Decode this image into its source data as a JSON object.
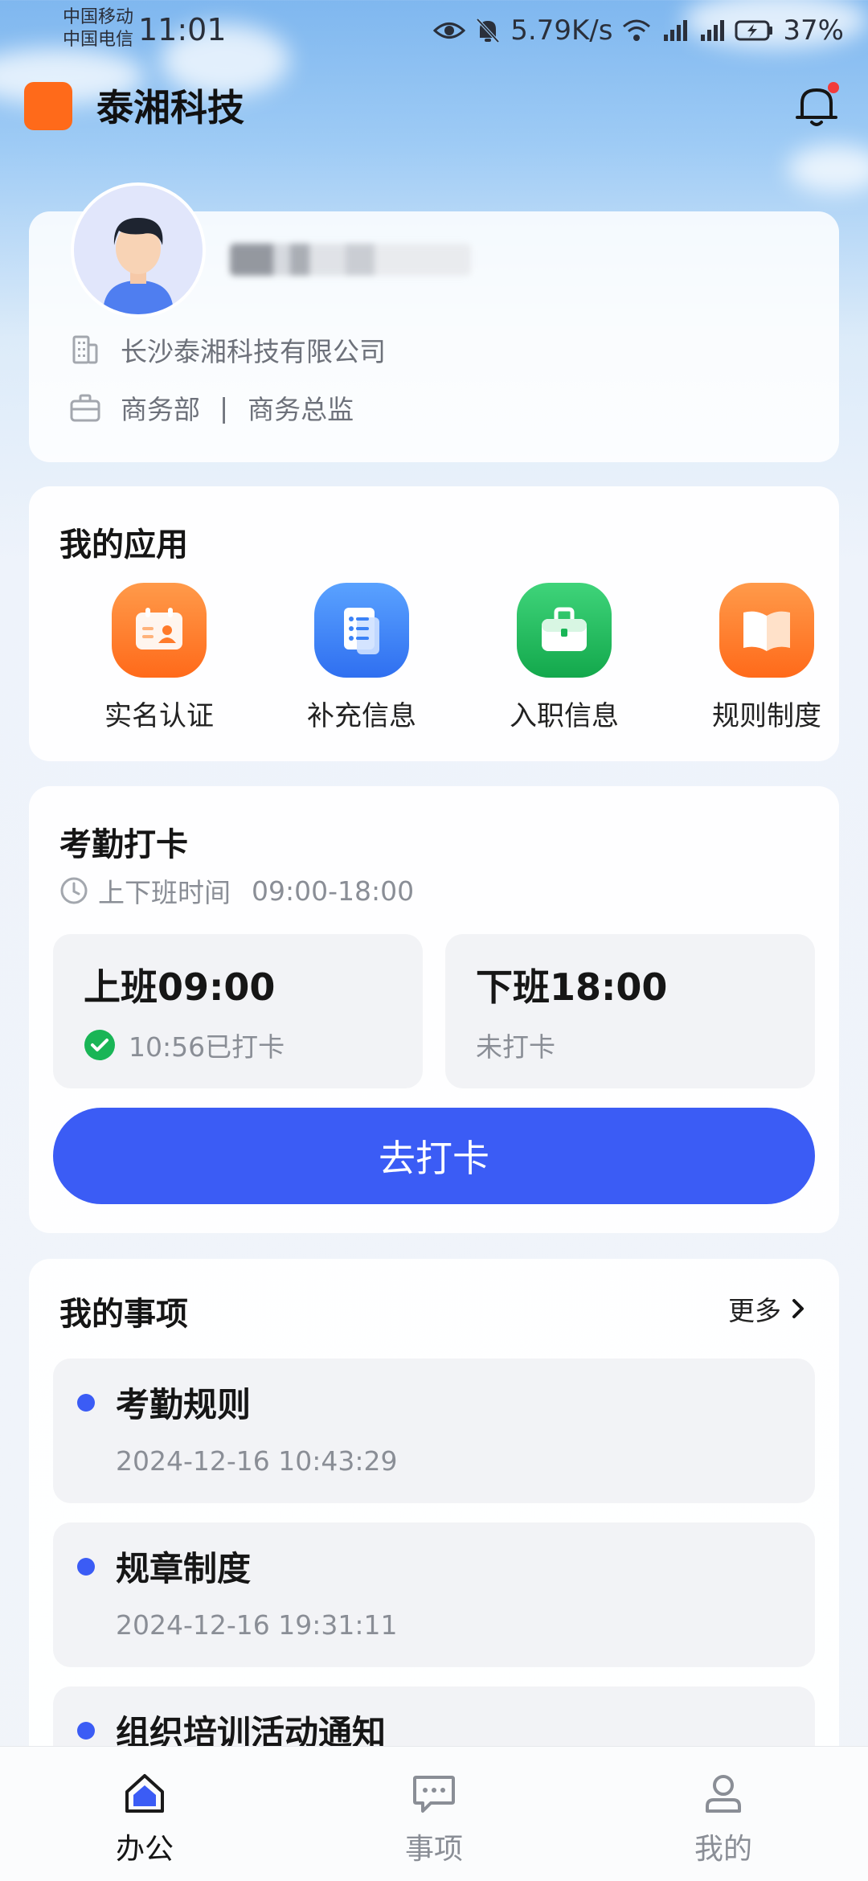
{
  "status_bar": {
    "carrier_1": "中国移动",
    "carrier_2": "中国电信",
    "time": "11:01",
    "net_speed": "5.79K/s",
    "battery": "37%",
    "icons": [
      "eye-icon",
      "mute-bell-icon",
      "wifi-icon",
      "signal-4g-icon",
      "signal-4g-icon",
      "battery-charging-icon"
    ]
  },
  "header": {
    "title": "泰湘科技",
    "logo_color": "#ff6a1a",
    "bell_icon": "bell-icon",
    "has_notification_dot": true
  },
  "profile": {
    "company": "长沙泰湘科技有限公司",
    "department": "商务部",
    "position": "商务总监",
    "separator": "|"
  },
  "apps": {
    "title": "我的应用",
    "items": [
      {
        "label": "实名认证",
        "icon": "id-card-icon",
        "color": "#ff6a1a"
      },
      {
        "label": "补充信息",
        "icon": "document-icon",
        "color": "#3b82f6"
      },
      {
        "label": "入职信息",
        "icon": "briefcase-icon",
        "color": "#19b556"
      },
      {
        "label": "规则制度",
        "icon": "book-icon",
        "color": "#ff6a1a"
      }
    ]
  },
  "attendance": {
    "title": "考勤打卡",
    "hours_label": "上下班时间",
    "hours_value": "09:00-18:00",
    "checkin": {
      "title": "上班09:00",
      "status": "10:56已打卡"
    },
    "checkout": {
      "title": "下班18:00",
      "status": "未打卡"
    },
    "button": "去打卡",
    "accent_color": "#3b5cf5"
  },
  "matters": {
    "title": "我的事项",
    "more": "更多",
    "items": [
      {
        "title": "考勤规则",
        "time": "2024-12-16 10:43:29"
      },
      {
        "title": "规章制度",
        "time": "2024-12-16 19:31:11"
      },
      {
        "title": "组织培训活动通知",
        "time": ""
      }
    ]
  },
  "tabbar": {
    "tabs": [
      {
        "label": "办公",
        "icon": "home-icon",
        "active": true
      },
      {
        "label": "事项",
        "icon": "chat-icon",
        "active": false
      },
      {
        "label": "我的",
        "icon": "user-icon",
        "active": false
      }
    ]
  }
}
